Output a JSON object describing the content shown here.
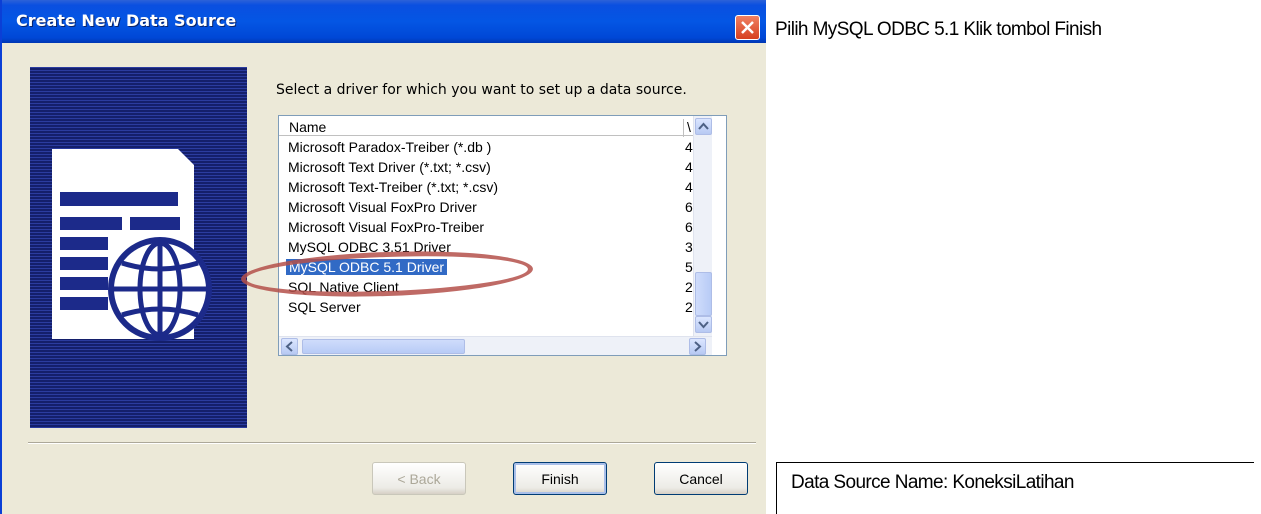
{
  "window": {
    "title": "Create New Data Source"
  },
  "instruction": "Select a driver for which you want to set up a data source.",
  "list": {
    "columns": {
      "name": "Name",
      "version": "\\"
    },
    "rows": [
      {
        "name": "Microsoft Paradox-Treiber (*.db )",
        "version": "4"
      },
      {
        "name": "Microsoft Text Driver (*.txt; *.csv)",
        "version": "4"
      },
      {
        "name": "Microsoft Text-Treiber (*.txt; *.csv)",
        "version": "4"
      },
      {
        "name": "Microsoft Visual FoxPro Driver",
        "version": "6"
      },
      {
        "name": "Microsoft Visual FoxPro-Treiber",
        "version": "6"
      },
      {
        "name": "MySQL ODBC 3.51 Driver",
        "version": "3"
      },
      {
        "name": "MySQL ODBC 5.1 Driver",
        "version": "5",
        "selected": true
      },
      {
        "name": "SQL Native Client",
        "version": "2"
      },
      {
        "name": "SQL Server",
        "version": "2"
      }
    ]
  },
  "buttons": {
    "back": "< Back",
    "finish": "Finish",
    "cancel": "Cancel"
  },
  "captions": {
    "top": "Pilih MySQL ODBC 5.1 Klik tombol Finish",
    "bottom": "Data Source Name: KoneksiLatihan"
  },
  "colors": {
    "titlebar": "#0456e4",
    "selection": "#316ac5",
    "highlight_ellipse": "#b4504a"
  },
  "icons": {
    "close": "close-icon",
    "banner": "data-source-globe-icon"
  }
}
